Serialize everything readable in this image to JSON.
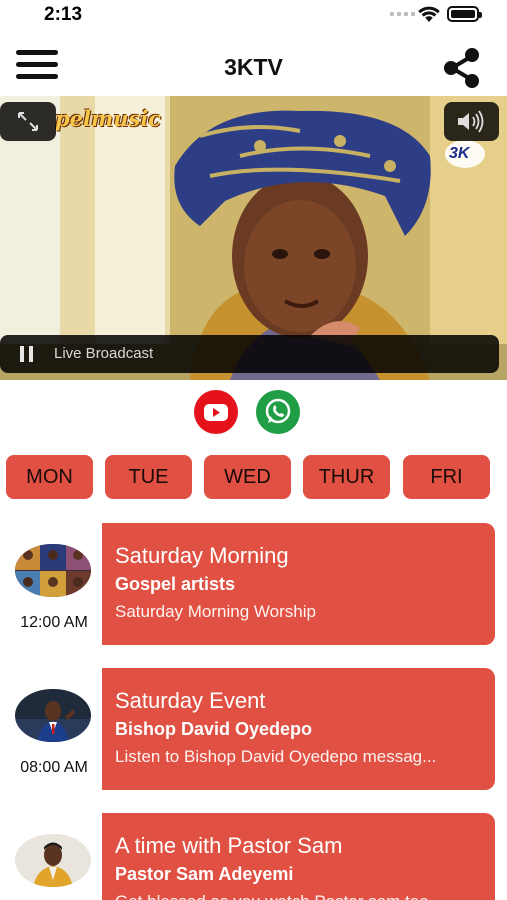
{
  "status_bar": {
    "time": "2:13"
  },
  "nav": {
    "title": "3KTV"
  },
  "video": {
    "logo_text": "pelmusic",
    "channel_logo": "3K",
    "status_label": "Live Broadcast",
    "icons": {
      "fullscreen": "expand-arrows-icon",
      "volume": "speaker-icon",
      "pause": "pause-icon"
    }
  },
  "social": {
    "youtube": "youtube-icon",
    "whatsapp": "whatsapp-icon"
  },
  "days": [
    "MON",
    "TUE",
    "WED",
    "THUR",
    "FRI"
  ],
  "schedule": [
    {
      "time": "12:00 AM",
      "title": "Saturday Morning",
      "host": "Gospel artists",
      "description": "Saturday Morning Worship"
    },
    {
      "time": "08:00 AM",
      "title": "Saturday Event",
      "host": "Bishop David Oyedepo",
      "description": "Listen to Bishop David Oyedepo messag..."
    },
    {
      "time": "",
      "title": "A time with Pastor Sam",
      "host": "Pastor Sam Adeyemi",
      "description": "Get blessed as you watch Pastor sam tea"
    }
  ],
  "colors": {
    "accent": "#e05043",
    "youtube": "#e5121b",
    "whatsapp": "#1f9e45"
  }
}
